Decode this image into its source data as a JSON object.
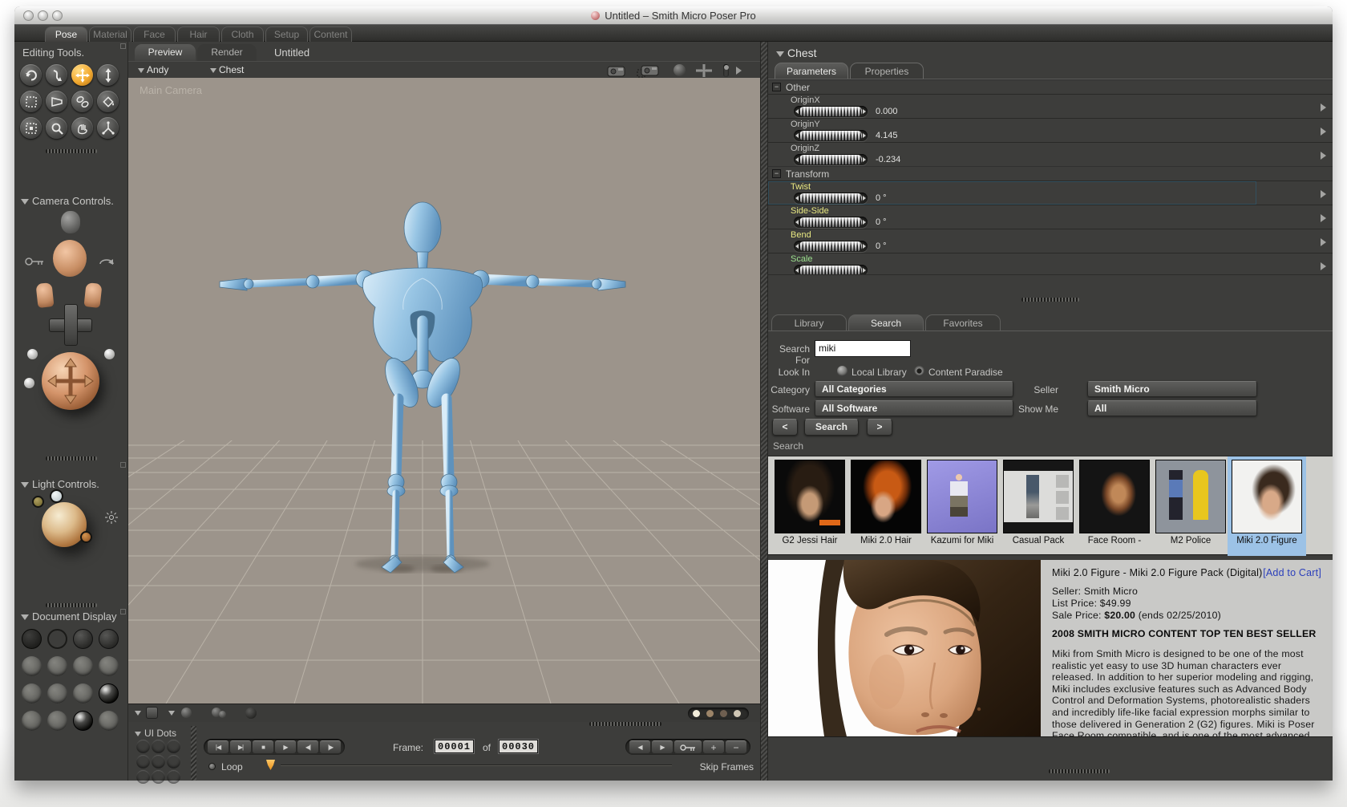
{
  "window": {
    "title": "Untitled – Smith Micro Poser Pro"
  },
  "main_tabs": [
    {
      "label": "Pose"
    },
    {
      "label": "Material"
    },
    {
      "label": "Face"
    },
    {
      "label": "Hair"
    },
    {
      "label": "Cloth"
    },
    {
      "label": "Setup"
    },
    {
      "label": "Content"
    }
  ],
  "sidebar": {
    "editing_tools_label": "Editing Tools.",
    "camera_controls_label": "Camera Controls.",
    "light_controls_label": "Light Controls.",
    "document_display_label": "Document Display"
  },
  "document": {
    "tab_preview": "Preview",
    "tab_render": "Render",
    "doc_title": "Untitled",
    "figure_menu": "Andy",
    "actor_menu": "Chest",
    "camera_label": "Main Camera"
  },
  "timeline": {
    "ui_dots": "UI Dots",
    "frame_label": "Frame:",
    "frame_current": "00001",
    "of": "of",
    "frame_total": "00030",
    "loop": "Loop",
    "skip_frames": "Skip Frames"
  },
  "parameters": {
    "actor": "Chest",
    "tab_parameters": "Parameters",
    "tab_properties": "Properties",
    "group_other": "Other",
    "group_transform": "Transform",
    "minus": "−",
    "rows": [
      {
        "label": "OriginX",
        "value": "0.000"
      },
      {
        "label": "OriginY",
        "value": "4.145"
      },
      {
        "label": "OriginZ",
        "value": "-0.234"
      },
      {
        "label": "Twist",
        "value": "0 °"
      },
      {
        "label": "Side-Side",
        "value": "0 °"
      },
      {
        "label": "Bend",
        "value": "0 °"
      },
      {
        "label": "Scale",
        "value": ""
      }
    ]
  },
  "library": {
    "tab_library": "Library",
    "tab_search": "Search",
    "tab_favorites": "Favorites",
    "search_for_label": "Search For",
    "search_value": "miki",
    "look_in_label": "Look In",
    "option_local": "Local Library",
    "option_paradise": "Content Paradise",
    "category_label": "Category",
    "category_value": "All Categories",
    "seller_label": "Seller",
    "seller_value": "Smith Micro",
    "software_label": "Software",
    "software_value": "All Software",
    "show_me_label": "Show Me",
    "show_me_value": "All",
    "prev": "<",
    "search_button": "Search",
    "next": ">",
    "results_label": "Search",
    "results": [
      {
        "caption": "G2 Jessi Hair"
      },
      {
        "caption": "Miki 2.0 Hair"
      },
      {
        "caption": "Kazumi for Miki"
      },
      {
        "caption": "Casual Pack"
      },
      {
        "caption": "Face Room -"
      },
      {
        "caption": "M2 Police"
      },
      {
        "caption": "Miki 2.0 Figure"
      }
    ]
  },
  "detail": {
    "title": "Miki 2.0 Figure - Miki 2.0 Figure Pack (Digital)",
    "add_to_cart": "[Add to Cart]",
    "seller": "Seller: Smith Micro",
    "list_price": "List Price: $49.99",
    "sale_prefix": "Sale Price: ",
    "sale_amount": "$20.00",
    "sale_suffix": " (ends 02/25/2010)",
    "banner": "2008 SMITH MICRO CONTENT TOP TEN BEST SELLER",
    "description": "Miki from Smith Micro is designed to be one of the most realistic yet easy to use 3D human characters ever released. In addition to her superior modeling and rigging, Miki includes exclusive features such as Advanced Body Control and Deformation Systems, photorealistic shaders and incredibly life-like facial expression morphs similar to those delivered in Generation 2 (G2) figures. Miki is Poser Face Room compatible, and is one of the most advanced and human figures with Poser dynamic simulation."
  },
  "colors": {
    "accent_orange": "#f0a431",
    "highlight_blue": "#4a6a85",
    "link_blue": "#2b3fbb",
    "selected_thumb": "#9cc2e6"
  }
}
